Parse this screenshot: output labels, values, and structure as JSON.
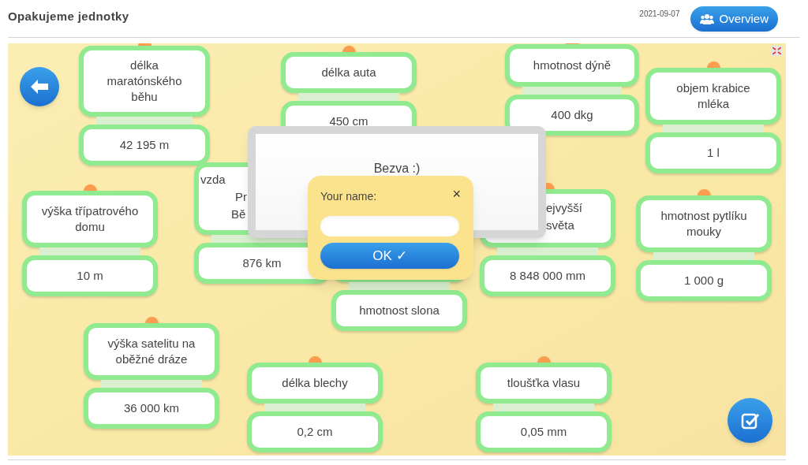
{
  "header": {
    "title": "Opakujeme jednotky",
    "date": "2021-09-07",
    "overview_button": "Overview"
  },
  "board": {
    "cards": [
      {
        "kind": "full",
        "label": "délka maratónského běhu",
        "value": "42 195 m"
      },
      {
        "kind": "full",
        "label": "délka auta",
        "value": "450 cm"
      },
      {
        "kind": "full",
        "label": "hmotnost dýně",
        "value": "400 dkg"
      },
      {
        "kind": "full",
        "label": "objem krabice mléka",
        "value": "1 l"
      },
      {
        "kind": "full",
        "label": "výška třípatrového domu",
        "value": "10 m"
      },
      {
        "kind": "covered",
        "label_lines": [
          "vzda",
          "Pr",
          "Bě"
        ],
        "value": "876 km"
      },
      {
        "kind": "covered",
        "label_lines": [
          "ejvyšší",
          "světa"
        ],
        "value": "8 848 000 mm"
      },
      {
        "kind": "covered",
        "value": "hmotnost slona"
      },
      {
        "kind": "full",
        "label": "hmotnost pytlíku mouky",
        "value": "1 000 g"
      },
      {
        "kind": "full",
        "label": "výška satelitu na oběžné dráze",
        "value": "36 000 km"
      },
      {
        "kind": "full",
        "label": "délka blechy",
        "value": "0,2 cm"
      },
      {
        "kind": "full",
        "label": "tloušťka vlasu",
        "value": "0,05 mm"
      }
    ]
  },
  "result_dialog": {
    "message": "Bezva :)"
  },
  "name_popup": {
    "label": "Your name:",
    "close": "×",
    "ok_button": "OK ✓"
  }
}
